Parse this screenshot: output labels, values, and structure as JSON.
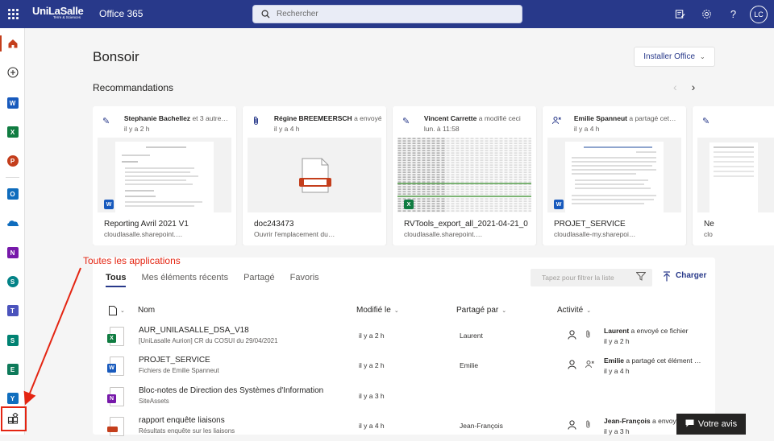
{
  "topbar": {
    "brand": "UniLaSalle",
    "brand_sub": "Terre & Sciences",
    "app_name": "Office 365",
    "search_placeholder": "Rechercher",
    "avatar_initials": "LC"
  },
  "rail": {
    "apps": [
      {
        "name": "home",
        "letter": "⌂",
        "color": "#c43e1c"
      },
      {
        "name": "create",
        "letter": "+",
        "color": "#323130"
      },
      {
        "name": "word",
        "letter": "W",
        "color": "#185abd"
      },
      {
        "name": "excel",
        "letter": "X",
        "color": "#107c41"
      },
      {
        "name": "powerpoint",
        "letter": "P",
        "color": "#c43e1c"
      },
      {
        "name": "outlook",
        "letter": "O",
        "color": "#0f6cbd"
      },
      {
        "name": "onedrive",
        "letter": "☁",
        "color": "#0f6cbd"
      },
      {
        "name": "onenote",
        "letter": "N",
        "color": "#7719aa"
      },
      {
        "name": "sharepoint",
        "letter": "S",
        "color": "#038387"
      },
      {
        "name": "teams",
        "letter": "T",
        "color": "#4b53bc"
      },
      {
        "name": "sway",
        "letter": "S",
        "color": "#008272"
      },
      {
        "name": "exchange",
        "letter": "E",
        "color": "#0e7a5a"
      },
      {
        "name": "yammer",
        "letter": "Y",
        "color": "#106ebe"
      }
    ]
  },
  "main": {
    "greeting": "Bonsoir",
    "install_label": "Installer Office",
    "recommendations_title": "Recommandations"
  },
  "cards": [
    {
      "person": "Stephanie Bachellez",
      "action": "et 3 autre…",
      "time": "il y a 2 h",
      "title": "Reporting Avril 2021 V1",
      "subtitle": "cloudlasalle.sharepoint.…",
      "app": "word",
      "head_icon": "✎"
    },
    {
      "person": "Régine BREEMEERSCH",
      "action": "a envoyé…",
      "time": "il y a 4 h",
      "title": "doc243473",
      "subtitle": "Ouvrir l'emplacement du…",
      "app": "pdf",
      "head_icon": "📎"
    },
    {
      "person": "Vincent Carrette",
      "action": "a modifié ceci",
      "time": "lun. à 11:58",
      "title": "RVTools_export_all_2021-04-21_0…",
      "subtitle": "cloudlasalle.sharepoint.…",
      "app": "excel",
      "head_icon": "✎"
    },
    {
      "person": "Emilie Spanneut",
      "action": "a partagé cet…",
      "time": "il y a 4 h",
      "title": "PROJET_SERVICE",
      "subtitle": "cloudlasalle-my.sharepoi…",
      "app": "word",
      "head_icon": "👥"
    },
    {
      "person": "",
      "action": "",
      "time": "",
      "title": "Ne",
      "subtitle": "clo",
      "app": "none",
      "head_icon": "✎"
    }
  ],
  "annotation": {
    "label": "Toutes les applications"
  },
  "files": {
    "tabs": [
      "Tous",
      "Mes éléments récents",
      "Partagé",
      "Favoris"
    ],
    "filter_placeholder": "Tapez pour filtrer la liste",
    "upload_label": "Charger",
    "columns": {
      "name": "Nom",
      "modified": "Modifié le",
      "shared": "Partagé par",
      "activity": "Activité"
    },
    "rows": [
      {
        "name": "AUR_UNILASALLE_DSA_V18",
        "sub": "[UniLasalle Aurion] CR du COSUI du 29/04/2021",
        "modified": "il y a 2 h",
        "shared_by": "Laurent",
        "act_person": "Laurent",
        "act_text": "a envoyé ce fichier",
        "act_time": "il y a 2 h",
        "app": "excel"
      },
      {
        "name": "PROJET_SERVICE",
        "sub": "Fichiers de Emilie Spanneut",
        "modified": "il y a 2 h",
        "shared_by": "Emilie",
        "act_person": "Emilie",
        "act_text": "a partagé cet élément …",
        "act_time": "il y a 4 h",
        "app": "word"
      },
      {
        "name": "Bloc-notes de Direction des Systèmes d'Information",
        "sub": "SiteAssets",
        "modified": "il y a 3 h",
        "shared_by": "",
        "act_person": "",
        "act_text": "",
        "act_time": "",
        "app": "onenote"
      },
      {
        "name": "rapport enquête liaisons",
        "sub": "Résultats enquête sur les liaisons",
        "modified": "il y a 4 h",
        "shared_by": "Jean-François",
        "act_person": "Jean-François",
        "act_text": "a envoyé",
        "act_time": "il y a 3 h",
        "app": "pdf"
      }
    ]
  },
  "feedback_label": "Votre avis",
  "colors": {
    "accent": "#28398a",
    "annotation": "#e42512"
  }
}
